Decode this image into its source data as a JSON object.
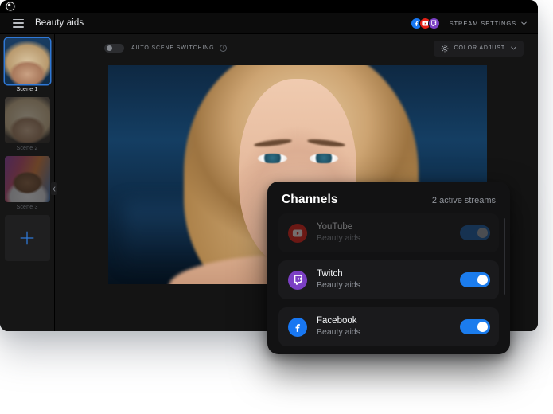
{
  "window": {
    "logo_icon": "restream-logo-icon",
    "menu_icon": "hamburger-menu-icon",
    "project_title": "Beauty aids"
  },
  "topbar": {
    "socials": [
      {
        "name": "facebook",
        "icon": "facebook-icon",
        "color": "#1877F2",
        "glyph": "f"
      },
      {
        "name": "youtube",
        "icon": "youtube-icon",
        "color": "#E62117",
        "glyph": "▶"
      },
      {
        "name": "twitch",
        "icon": "twitch-icon",
        "color": "#7B3FC4",
        "glyph": "▮"
      }
    ],
    "stream_settings_label": "STREAM SETTINGS",
    "chevron_icon": "chevron-down-icon"
  },
  "sidebar": {
    "scenes": [
      {
        "label": "Scene 1",
        "active": true
      },
      {
        "label": "Scene 2",
        "active": false
      },
      {
        "label": "Scene 3",
        "active": false
      }
    ],
    "add_scene_icon": "plus-icon",
    "collapse_icon": "chevron-left-icon"
  },
  "toolbar": {
    "auto_scene_switching_label": "AUTO SCENE SWITCHING",
    "auto_scene_switching_on": false,
    "info_icon": "info-icon",
    "info_glyph": "i",
    "color_adjust_label": "COLOR ADJUST",
    "color_adjust_icon": "brightness-icon",
    "chevron_icon": "chevron-down-icon"
  },
  "video_controls": {
    "mute_icon": "speaker-muted-icon",
    "camera_icon": "camera-icon"
  },
  "channels": {
    "title": "Channels",
    "active_streams_text": "2 active streams",
    "rows": [
      {
        "platform": "YouTube",
        "subtitle": "Beauty aids",
        "icon": "youtube-icon",
        "enabled": true,
        "dimmed": true
      },
      {
        "platform": "Twitch",
        "subtitle": "Beauty aids",
        "icon": "twitch-icon",
        "enabled": true,
        "dimmed": false
      },
      {
        "platform": "Facebook",
        "subtitle": "Beauty aids",
        "icon": "facebook-icon",
        "enabled": true,
        "dimmed": false
      }
    ]
  },
  "colors": {
    "accent_blue": "#1b7ced",
    "youtube_red": "#E62117",
    "twitch_purple": "#7B3FC4",
    "facebook_blue": "#1877F2",
    "window_bg": "#141414",
    "panel_bg": "#121213"
  }
}
